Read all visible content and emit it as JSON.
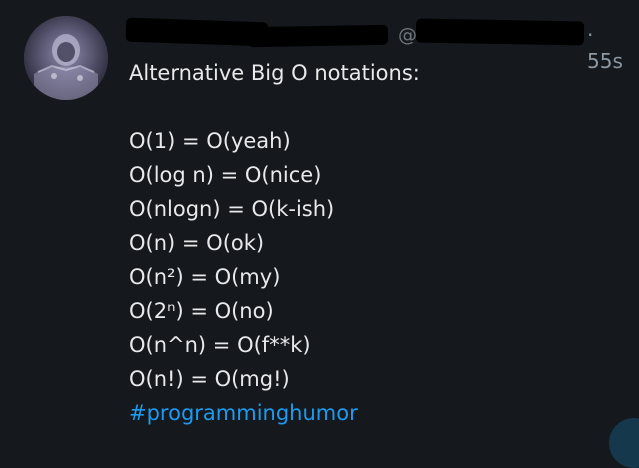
{
  "tweet": {
    "handle_prefix": "@",
    "timestamp": "· 55s",
    "lines": [
      "Alternative Big O notations:",
      "",
      "O(1) = O(yeah)",
      "O(log n) = O(nice)",
      "O(nlogn) = O(k-ish)",
      "O(n) = O(ok)",
      "O(n²) = O(my)",
      "O(2ⁿ) = O(no)",
      "O(n^n) = O(f**k)",
      "O(n!) = O(mg!)"
    ],
    "hashtag": "#programminghumor"
  },
  "colors": {
    "background": "#15181c",
    "text": "#e7e9ea",
    "muted": "#8b98a5",
    "link": "#1d9bf0"
  }
}
